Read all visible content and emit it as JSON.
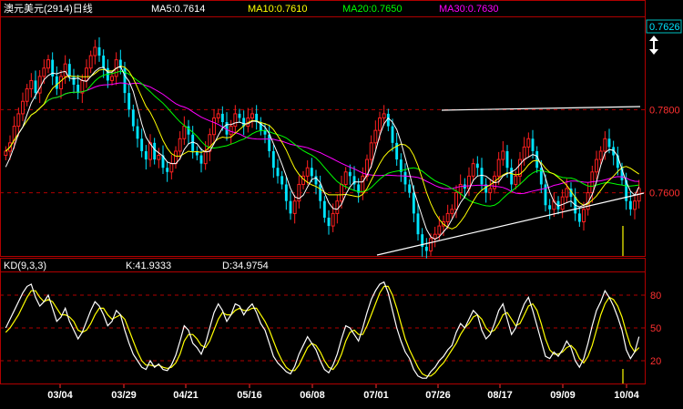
{
  "header": {
    "title": "澳元美元(2914)日线",
    "ma": [
      {
        "label": "MA5:0.7614",
        "color": "#ffffff"
      },
      {
        "label": "MA10:0.7610",
        "color": "#ffff00"
      },
      {
        "label": "MA20:0.7650",
        "color": "#00ff00"
      },
      {
        "label": "MA30:0.7630",
        "color": "#ff00ff"
      }
    ]
  },
  "price_axis": {
    "current": "0.7626",
    "ticks": [
      {
        "value": 0.78,
        "label": "0.7800"
      },
      {
        "value": 0.76,
        "label": "0.7600"
      }
    ]
  },
  "kd": {
    "title": "KD(9,3,3)",
    "k_label": "K:41.9333",
    "d_label": "D:34.9754",
    "ticks": [
      {
        "value": 80,
        "label": "80"
      },
      {
        "value": 50,
        "label": "50"
      },
      {
        "value": 20,
        "label": "20"
      }
    ]
  },
  "dates": [
    "03/04",
    "03/29",
    "04/21",
    "05/16",
    "06/08",
    "07/01",
    "07/26",
    "08/17",
    "09/09",
    "10/04"
  ],
  "chart_data": {
    "type": "line",
    "title": "澳元美元(2914)日线",
    "x_ticks": [
      "03/04",
      "03/29",
      "04/21",
      "05/16",
      "06/08",
      "07/01",
      "07/26",
      "08/17",
      "09/09",
      "10/04"
    ],
    "price_ylim": [
      0.745,
      0.802
    ],
    "kd_ylim": [
      0,
      100
    ],
    "candle_count": 150,
    "price_series": [
      {
        "name": "MA5",
        "value": 0.7614
      },
      {
        "name": "MA10",
        "value": 0.761
      },
      {
        "name": "MA20",
        "value": 0.765
      },
      {
        "name": "MA30",
        "value": 0.763
      }
    ],
    "close": [
      0.77,
      0.772,
      0.776,
      0.779,
      0.782,
      0.785,
      0.787,
      0.784,
      0.788,
      0.79,
      0.792,
      0.788,
      0.785,
      0.788,
      0.791,
      0.788,
      0.786,
      0.784,
      0.787,
      0.79,
      0.793,
      0.795,
      0.793,
      0.79,
      0.787,
      0.788,
      0.792,
      0.79,
      0.784,
      0.78,
      0.776,
      0.773,
      0.77,
      0.768,
      0.772,
      0.768,
      0.769,
      0.766,
      0.765,
      0.767,
      0.77,
      0.773,
      0.776,
      0.774,
      0.77,
      0.769,
      0.767,
      0.77,
      0.774,
      0.778,
      0.779,
      0.777,
      0.774,
      0.776,
      0.779,
      0.778,
      0.776,
      0.778,
      0.779,
      0.777,
      0.775,
      0.774,
      0.77,
      0.766,
      0.764,
      0.762,
      0.758,
      0.755,
      0.758,
      0.762,
      0.764,
      0.766,
      0.764,
      0.762,
      0.758,
      0.754,
      0.752,
      0.755,
      0.758,
      0.762,
      0.765,
      0.764,
      0.762,
      0.76,
      0.764,
      0.768,
      0.772,
      0.775,
      0.778,
      0.779,
      0.776,
      0.772,
      0.768,
      0.765,
      0.762,
      0.76,
      0.755,
      0.75,
      0.747,
      0.746,
      0.749,
      0.75,
      0.752,
      0.753,
      0.755,
      0.756,
      0.76,
      0.762,
      0.761,
      0.764,
      0.767,
      0.766,
      0.762,
      0.76,
      0.761,
      0.764,
      0.768,
      0.77,
      0.766,
      0.762,
      0.764,
      0.768,
      0.771,
      0.773,
      0.77,
      0.766,
      0.762,
      0.757,
      0.756,
      0.758,
      0.756,
      0.759,
      0.761,
      0.759,
      0.755,
      0.753,
      0.756,
      0.76,
      0.765,
      0.768,
      0.77,
      0.773,
      0.771,
      0.769,
      0.766,
      0.763,
      0.758,
      0.756,
      0.758,
      0.761
    ],
    "ma5": [
      0.7662,
      0.7684,
      0.7712,
      0.7742,
      0.7758,
      0.7788,
      0.7816,
      0.7834,
      0.7852,
      0.7872,
      0.7882,
      0.7888,
      0.7886,
      0.789,
      0.7892,
      0.7876,
      0.7874,
      0.7876,
      0.787,
      0.7868,
      0.788,
      0.7892,
      0.79,
      0.7902,
      0.789,
      0.789,
      0.79,
      0.7904,
      0.7882,
      0.7868,
      0.7844,
      0.7806,
      0.7766,
      0.7734,
      0.7718,
      0.7704,
      0.7696,
      0.7688,
      0.7674,
      0.767,
      0.767,
      0.7682,
      0.7704,
      0.7718,
      0.7722,
      0.7718,
      0.7704,
      0.7698,
      0.77,
      0.7718,
      0.7738,
      0.7756,
      0.7764,
      0.7764,
      0.7768,
      0.777,
      0.7766,
      0.7766,
      0.7772,
      0.7772,
      0.7766,
      0.7758,
      0.7742,
      0.7718,
      0.7694,
      0.7668,
      0.764,
      0.761,
      0.759,
      0.7586,
      0.7594,
      0.7614,
      0.7632,
      0.7636,
      0.7624,
      0.76,
      0.7576,
      0.7562,
      0.756,
      0.7572,
      0.7596,
      0.7614,
      0.7626,
      0.7626,
      0.7626,
      0.7642,
      0.7664,
      0.77,
      0.7738,
      0.7766,
      0.778,
      0.777,
      0.7752,
      0.7722,
      0.7684,
      0.7646,
      0.7606,
      0.7574,
      0.7542,
      0.7512,
      0.7494,
      0.7488,
      0.7494,
      0.7506,
      0.7518,
      0.7536,
      0.7556,
      0.7576,
      0.759,
      0.7608,
      0.763,
      0.764,
      0.7642,
      0.764,
      0.7632,
      0.7624,
      0.7626,
      0.764,
      0.7646,
      0.765,
      0.7656,
      0.7668,
      0.768,
      0.7686,
      0.7692,
      0.7688,
      0.7666,
      0.7636,
      0.7602,
      0.7578,
      0.7568,
      0.7572,
      0.7576,
      0.758,
      0.757,
      0.7566,
      0.757,
      0.7576,
      0.7596,
      0.7626,
      0.7666,
      0.7696,
      0.7704,
      0.7702,
      0.7688,
      0.7656,
      0.7626,
      0.7604,
      0.7594,
      0.7614
    ],
    "kd_k": [
      50,
      58,
      66,
      74,
      82,
      88,
      90,
      78,
      70,
      74,
      80,
      68,
      56,
      60,
      68,
      56,
      48,
      40,
      46,
      56,
      66,
      74,
      70,
      62,
      52,
      56,
      66,
      62,
      48,
      36,
      26,
      20,
      14,
      12,
      20,
      14,
      17,
      12,
      11,
      16,
      25,
      38,
      52,
      48,
      36,
      32,
      26,
      36,
      50,
      64,
      72,
      66,
      56,
      62,
      72,
      70,
      62,
      68,
      72,
      64,
      54,
      48,
      36,
      24,
      18,
      14,
      10,
      8,
      15,
      26,
      34,
      42,
      36,
      30,
      20,
      12,
      9,
      16,
      26,
      40,
      52,
      50,
      44,
      38,
      50,
      64,
      76,
      84,
      90,
      92,
      82,
      66,
      50,
      38,
      28,
      22,
      12,
      6,
      4,
      4,
      10,
      14,
      20,
      24,
      30,
      34,
      46,
      54,
      50,
      58,
      66,
      62,
      48,
      40,
      44,
      54,
      66,
      72,
      58,
      44,
      50,
      62,
      72,
      78,
      66,
      52,
      38,
      24,
      22,
      28,
      24,
      30,
      38,
      32,
      20,
      14,
      22,
      36,
      52,
      66,
      74,
      84,
      78,
      70,
      60,
      48,
      30,
      22,
      28,
      42
    ],
    "kd_d": [
      46,
      50,
      56,
      62,
      70,
      78,
      84,
      84,
      78,
      74,
      76,
      74,
      68,
      62,
      62,
      60,
      56,
      48,
      46,
      48,
      54,
      62,
      68,
      68,
      62,
      58,
      60,
      62,
      58,
      48,
      38,
      28,
      20,
      16,
      16,
      15,
      16,
      14,
      13,
      14,
      18,
      26,
      38,
      44,
      44,
      40,
      34,
      32,
      38,
      48,
      58,
      64,
      62,
      62,
      66,
      68,
      66,
      66,
      68,
      68,
      62,
      56,
      48,
      38,
      28,
      20,
      14,
      11,
      11,
      16,
      24,
      32,
      36,
      34,
      28,
      20,
      14,
      12,
      17,
      26,
      38,
      46,
      48,
      44,
      44,
      52,
      62,
      72,
      82,
      88,
      88,
      80,
      68,
      54,
      40,
      30,
      22,
      14,
      8,
      6,
      6,
      9,
      14,
      18,
      24,
      30,
      36,
      44,
      50,
      54,
      60,
      62,
      58,
      50,
      46,
      48,
      54,
      62,
      64,
      58,
      52,
      54,
      62,
      70,
      72,
      66,
      54,
      40,
      30,
      26,
      26,
      28,
      32,
      34,
      30,
      22,
      18,
      24,
      34,
      48,
      62,
      72,
      78,
      76,
      70,
      60,
      46,
      34,
      28,
      32
    ]
  }
}
